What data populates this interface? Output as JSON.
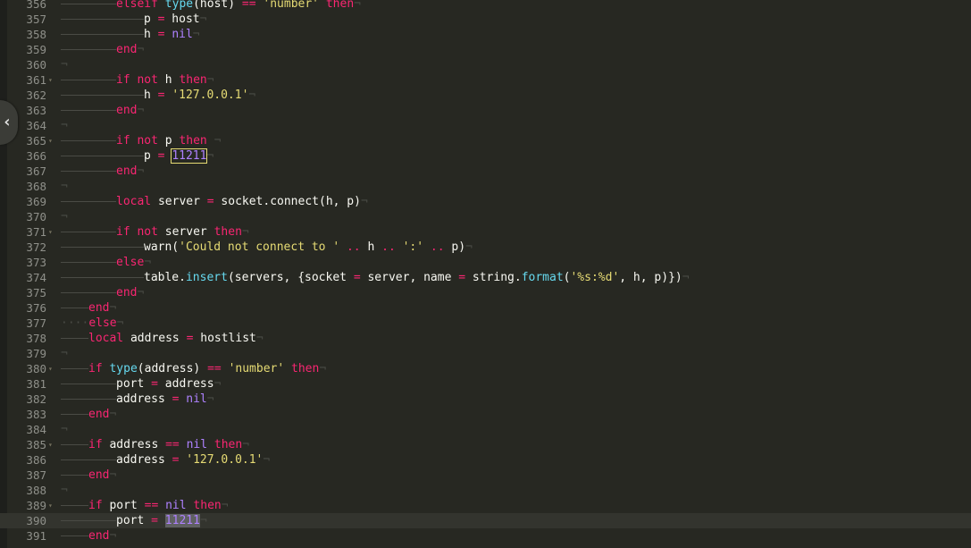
{
  "editor": {
    "collapse_glyph": "‹",
    "lines": [
      {
        "num": "356",
        "fold": false,
        "indent": "tt",
        "code": [
          [
            "k",
            "elseif"
          ],
          [
            "w",
            " "
          ],
          [
            "f",
            "type"
          ],
          [
            "w",
            "(host) "
          ],
          [
            "o",
            "=="
          ],
          [
            "w",
            " "
          ],
          [
            "s",
            "'number'"
          ],
          [
            "w",
            " "
          ],
          [
            "k",
            "then"
          ]
        ]
      },
      {
        "num": "357",
        "fold": false,
        "indent": "ttt",
        "code": [
          [
            "w",
            "p "
          ],
          [
            "o",
            "="
          ],
          [
            "w",
            " host"
          ]
        ]
      },
      {
        "num": "358",
        "fold": false,
        "indent": "ttt",
        "code": [
          [
            "w",
            "h "
          ],
          [
            "o",
            "="
          ],
          [
            "w",
            " "
          ],
          [
            "n",
            "nil"
          ]
        ]
      },
      {
        "num": "359",
        "fold": false,
        "indent": "tt",
        "code": [
          [
            "k",
            "end"
          ]
        ]
      },
      {
        "num": "360",
        "fold": false,
        "indent": "",
        "code": []
      },
      {
        "num": "361",
        "fold": true,
        "indent": "tt",
        "code": [
          [
            "k",
            "if"
          ],
          [
            "w",
            " "
          ],
          [
            "k",
            "not"
          ],
          [
            "w",
            " h "
          ],
          [
            "k",
            "then"
          ]
        ]
      },
      {
        "num": "362",
        "fold": false,
        "indent": "ttt",
        "code": [
          [
            "w",
            "h "
          ],
          [
            "o",
            "="
          ],
          [
            "w",
            " "
          ],
          [
            "s",
            "'127.0.0.1'"
          ]
        ]
      },
      {
        "num": "363",
        "fold": false,
        "indent": "tt",
        "code": [
          [
            "k",
            "end"
          ]
        ]
      },
      {
        "num": "364",
        "fold": false,
        "indent": "",
        "code": []
      },
      {
        "num": "365",
        "fold": true,
        "indent": "tt",
        "code": [
          [
            "k",
            "if"
          ],
          [
            "w",
            " "
          ],
          [
            "k",
            "not"
          ],
          [
            "w",
            " p "
          ],
          [
            "k",
            "then"
          ],
          [
            "w",
            " "
          ]
        ]
      },
      {
        "num": "366",
        "fold": false,
        "indent": "ttt",
        "code": [
          [
            "w",
            "p "
          ],
          [
            "o",
            "="
          ],
          [
            "w",
            " "
          ],
          [
            "nb",
            "11211"
          ]
        ]
      },
      {
        "num": "367",
        "fold": false,
        "indent": "tt",
        "code": [
          [
            "k",
            "end"
          ]
        ]
      },
      {
        "num": "368",
        "fold": false,
        "indent": "",
        "code": []
      },
      {
        "num": "369",
        "fold": false,
        "indent": "tt",
        "code": [
          [
            "k",
            "local"
          ],
          [
            "w",
            " server "
          ],
          [
            "o",
            "="
          ],
          [
            "w",
            " socket.connect(h, p)"
          ]
        ]
      },
      {
        "num": "370",
        "fold": false,
        "indent": "",
        "code": []
      },
      {
        "num": "371",
        "fold": true,
        "indent": "tt",
        "code": [
          [
            "k",
            "if"
          ],
          [
            "w",
            " "
          ],
          [
            "k",
            "not"
          ],
          [
            "w",
            " server "
          ],
          [
            "k",
            "then"
          ]
        ]
      },
      {
        "num": "372",
        "fold": false,
        "indent": "ttt",
        "code": [
          [
            "w",
            "warn("
          ],
          [
            "s",
            "'Could not connect to '"
          ],
          [
            "w",
            " "
          ],
          [
            "o",
            ".."
          ],
          [
            "w",
            " h "
          ],
          [
            "o",
            ".."
          ],
          [
            "w",
            " "
          ],
          [
            "s",
            "':'"
          ],
          [
            "w",
            " "
          ],
          [
            "o",
            ".."
          ],
          [
            "w",
            " p)"
          ]
        ]
      },
      {
        "num": "373",
        "fold": false,
        "indent": "tt",
        "code": [
          [
            "k",
            "else"
          ]
        ]
      },
      {
        "num": "374",
        "fold": false,
        "indent": "ttt",
        "code": [
          [
            "w",
            "table."
          ],
          [
            "f",
            "insert"
          ],
          [
            "w",
            "(servers, {socket "
          ],
          [
            "o",
            "="
          ],
          [
            "w",
            " server, name "
          ],
          [
            "o",
            "="
          ],
          [
            "w",
            " string."
          ],
          [
            "f",
            "format"
          ],
          [
            "w",
            "("
          ],
          [
            "s",
            "'%s:%d'"
          ],
          [
            "w",
            ", h, p)})"
          ]
        ]
      },
      {
        "num": "375",
        "fold": false,
        "indent": "tt",
        "code": [
          [
            "k",
            "end"
          ]
        ]
      },
      {
        "num": "376",
        "fold": false,
        "indent": "t",
        "code": [
          [
            "k",
            "end"
          ]
        ]
      },
      {
        "num": "377",
        "fold": false,
        "indent": "d",
        "code": [
          [
            "k",
            "else"
          ]
        ]
      },
      {
        "num": "378",
        "fold": false,
        "indent": "t",
        "code": [
          [
            "k",
            "local"
          ],
          [
            "w",
            " address "
          ],
          [
            "o",
            "="
          ],
          [
            "w",
            " hostlist"
          ]
        ]
      },
      {
        "num": "379",
        "fold": false,
        "indent": "",
        "code": []
      },
      {
        "num": "380",
        "fold": true,
        "indent": "t",
        "code": [
          [
            "k",
            "if"
          ],
          [
            "w",
            " "
          ],
          [
            "f",
            "type"
          ],
          [
            "w",
            "(address) "
          ],
          [
            "o",
            "=="
          ],
          [
            "w",
            " "
          ],
          [
            "s",
            "'number'"
          ],
          [
            "w",
            " "
          ],
          [
            "k",
            "then"
          ]
        ]
      },
      {
        "num": "381",
        "fold": false,
        "indent": "tt",
        "code": [
          [
            "w",
            "port "
          ],
          [
            "o",
            "="
          ],
          [
            "w",
            " address"
          ]
        ]
      },
      {
        "num": "382",
        "fold": false,
        "indent": "tt",
        "code": [
          [
            "w",
            "address "
          ],
          [
            "o",
            "="
          ],
          [
            "w",
            " "
          ],
          [
            "n",
            "nil"
          ]
        ]
      },
      {
        "num": "383",
        "fold": false,
        "indent": "t",
        "code": [
          [
            "k",
            "end"
          ]
        ]
      },
      {
        "num": "384",
        "fold": false,
        "indent": "",
        "code": []
      },
      {
        "num": "385",
        "fold": true,
        "indent": "t",
        "code": [
          [
            "k",
            "if"
          ],
          [
            "w",
            " address "
          ],
          [
            "o",
            "=="
          ],
          [
            "w",
            " "
          ],
          [
            "n",
            "nil"
          ],
          [
            "w",
            " "
          ],
          [
            "k",
            "then"
          ]
        ]
      },
      {
        "num": "386",
        "fold": false,
        "indent": "tt",
        "code": [
          [
            "w",
            "address "
          ],
          [
            "o",
            "="
          ],
          [
            "w",
            " "
          ],
          [
            "s",
            "'127.0.0.1'"
          ]
        ]
      },
      {
        "num": "387",
        "fold": false,
        "indent": "t",
        "code": [
          [
            "k",
            "end"
          ]
        ]
      },
      {
        "num": "388",
        "fold": false,
        "indent": "",
        "code": []
      },
      {
        "num": "389",
        "fold": true,
        "indent": "t",
        "code": [
          [
            "k",
            "if"
          ],
          [
            "w",
            " port "
          ],
          [
            "o",
            "=="
          ],
          [
            "w",
            " "
          ],
          [
            "n",
            "nil"
          ],
          [
            "w",
            " "
          ],
          [
            "k",
            "then"
          ]
        ]
      },
      {
        "num": "390",
        "fold": false,
        "indent": "tt",
        "current": true,
        "code": [
          [
            "w",
            "port "
          ],
          [
            "o",
            "="
          ],
          [
            "w",
            " "
          ],
          [
            "ns",
            "11211"
          ]
        ]
      },
      {
        "num": "391",
        "fold": false,
        "indent": "t",
        "code": [
          [
            "k",
            "end"
          ]
        ]
      }
    ]
  },
  "colors": {
    "background": "#272822",
    "keyword": "#f92672",
    "string": "#e6db74",
    "number": "#ae81ff",
    "function": "#66d9ef",
    "text": "#f8f8f2"
  }
}
